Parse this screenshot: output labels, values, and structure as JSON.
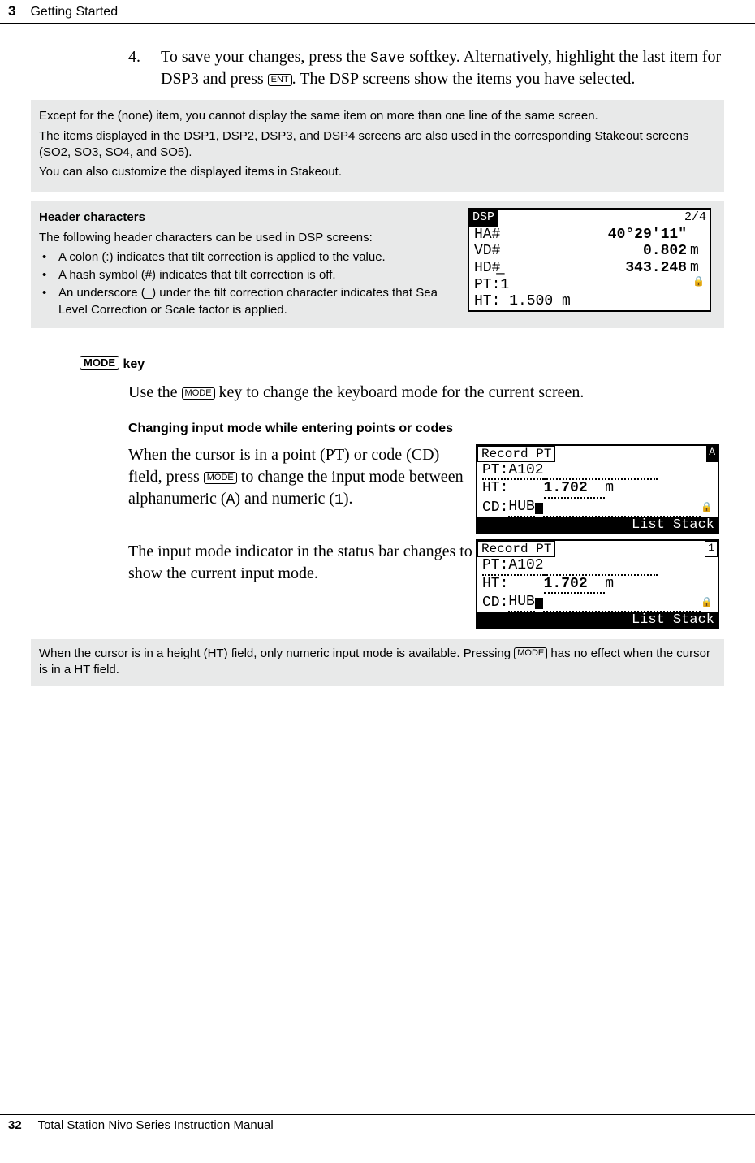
{
  "header": {
    "chapter_num": "3",
    "chapter_title": "Getting Started"
  },
  "step4": {
    "num": "4.",
    "text_before_code": "To save your changes, press the ",
    "code": "Save",
    "text_after_code": " softkey. Alternatively, highlight the last item for DSP3 and press ",
    "key": "ENT",
    "text_end": ". The DSP screens show the items you have selected."
  },
  "note1": {
    "p1": "Except for the (none) item, you cannot display the same item on more than one line of the same screen.",
    "p2": "The items displayed in the DSP1, DSP2, DSP3, and DSP4 screens are also used in the corresponding Stakeout screens (SO2, SO3, SO4, and SO5).",
    "p3": "You can also customize the displayed items in Stakeout."
  },
  "header_chars": {
    "title": "Header characters",
    "intro": "The following header characters can be used in DSP screens:",
    "bullets": [
      "A colon (:) indicates that tilt correction is applied to the value.",
      "A hash symbol (#) indicates that tilt correction is off.",
      "An underscore (_) under the tilt correction character indicates that Sea Level Correction or Scale factor is applied."
    ]
  },
  "lcd_dsp": {
    "title": "DSP",
    "page": "2/4",
    "rows": [
      {
        "label": "HA#",
        "val": "40°29'11\"",
        "unit": ""
      },
      {
        "label": "VD#",
        "val": "0.802",
        "unit": "m"
      },
      {
        "label": "HD#̲",
        "val": "343.248",
        "unit": "m"
      }
    ],
    "pt_line": "PT:1",
    "ht_line": "HT:  1.500 m"
  },
  "mode_section": {
    "heading_key": "MODE",
    "heading_suffix": " key",
    "p1_before": "Use the ",
    "p1_key": "MODE",
    "p1_after": " key to change the keyboard mode for the current screen."
  },
  "changing_mode": {
    "heading": "Changing input mode while entering points or codes",
    "p1_a": "When the cursor is in a point (PT) or code (CD) field, press ",
    "p1_key": "MODE",
    "p1_b": " to change the input mode between alphanumeric (",
    "p1_alpha": "A",
    "p1_c": ") and numeric (",
    "p1_num": "1",
    "p1_d": ").",
    "p2": "The input mode indicator in the status bar changes to show the current input mode."
  },
  "lcd_record_a": {
    "title": "Record PT",
    "mode": "A",
    "pt": "PT:A102",
    "ht": "HT:    1.702  m",
    "cd": "CD:HUB",
    "footer": "List Stack"
  },
  "lcd_record_1": {
    "title": "Record PT",
    "mode": "1",
    "pt": "PT:A102",
    "ht": "HT:    1.702  m",
    "cd": "CD:HUB",
    "footer": "List Stack"
  },
  "note2": {
    "t1": "When the cursor is in a height (HT) field, only numeric input mode is available. Pressing ",
    "key": "MODE",
    "t2": " has no effect when the cursor is in a HT field."
  },
  "footer": {
    "page_num": "32",
    "manual": "Total Station Nivo Series Instruction Manual"
  }
}
